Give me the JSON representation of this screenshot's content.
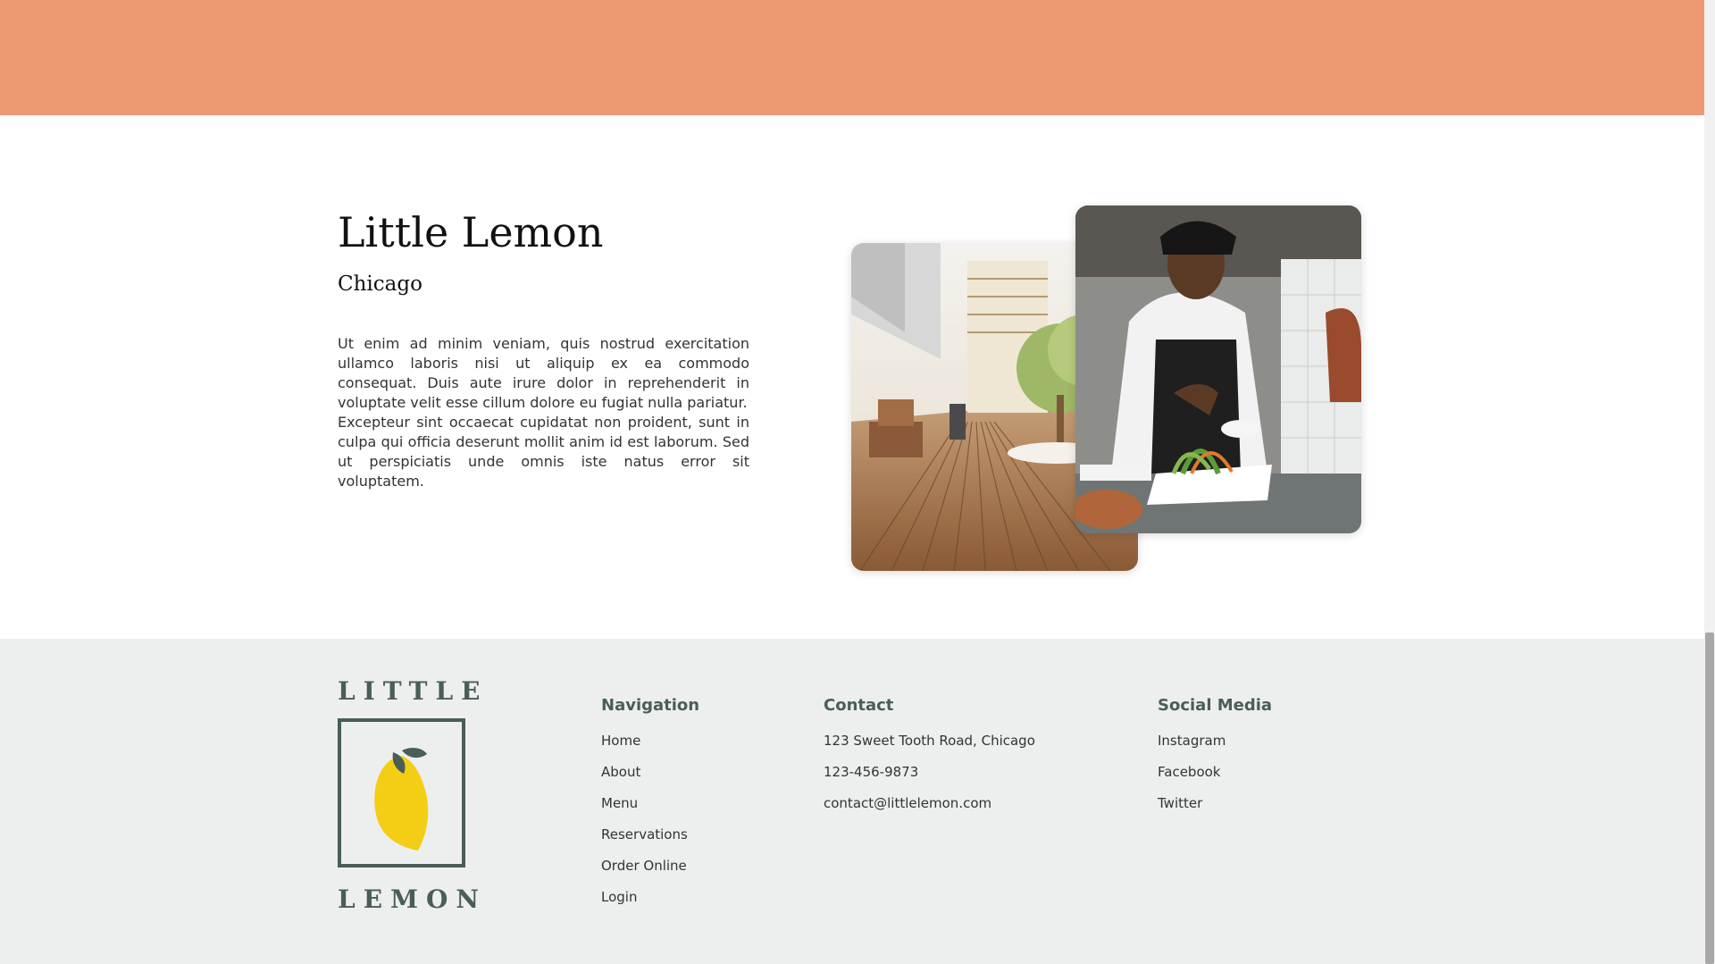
{
  "about": {
    "title": "Little Lemon",
    "subtitle": "Chicago",
    "paragraph_1": "Ut enim ad minim veniam, quis nostrud exercitation ullamco laboris nisi ut aliquip ex ea commodo consequat. Duis aute irure dolor in reprehenderit in voluptate velit esse cillum dolore eu fugiat nulla pariatur.",
    "paragraph_2": "Excepteur sint occaecat cupidatat non proident, sunt in culpa qui officia deserunt mollit anim id est laborum. Sed ut perspiciatis unde omnis iste natus error sit voluptatem."
  },
  "footer": {
    "logo": {
      "top_word": "LITTLE",
      "bottom_word": "LEMON"
    },
    "navigation": {
      "heading": "Navigation",
      "items": [
        "Home",
        "About",
        "Menu",
        "Reservations",
        "Order Online",
        "Login"
      ]
    },
    "contact": {
      "heading": "Contact",
      "items": [
        "123 Sweet Tooth Road, Chicago",
        "123-456-9873",
        "contact@littlelemon.com"
      ]
    },
    "social": {
      "heading": "Social Media",
      "items": [
        "Instagram",
        "Facebook",
        "Twitter"
      ]
    }
  },
  "colors": {
    "banner": "#ee9972",
    "footer_bg": "#edefee",
    "brand_green": "#495e57",
    "lemon_yellow": "#f4ce14"
  }
}
